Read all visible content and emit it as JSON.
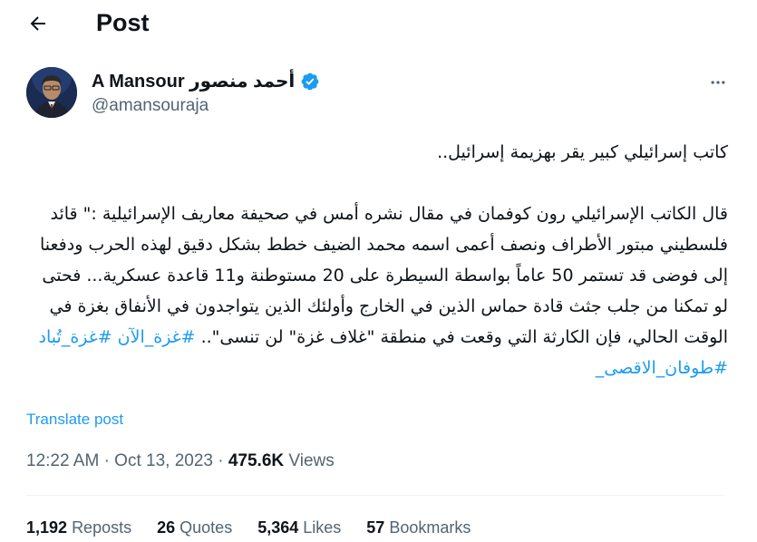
{
  "header": {
    "title": "Post"
  },
  "author": {
    "name": "A Mansour أحمد منصور",
    "handle": "@amansouraja",
    "verified": true
  },
  "tweet": {
    "line1": "كاتب إسرائيلي كبير يقر بهزيمة إسرائيل..",
    "body": "قال الكاتب الإسرائيلي رون كوفمان في مقال نشره أمس في صحيفة معاريف الإسرائيلية :\" قائد فلسطيني مبتور الأطراف ونصف أعمى اسمه محمد الضيف خطط بشكل دقيق لهذه الحرب ودفعنا إلى فوضى قد تستمر 50 عاماً بواسطة السيطرة على 20 مستوطنة و11 قاعدة عسكرية... فحتى لو تمكنا من جلب جثث قادة حماس الذين في الخارج وأولئك الذين يتواجدون في الأنفاق بغزة في الوقت الحالي، فإن الكارثة التي وقعت في منطقة \"غلاف غزة\" لن تنسى\"..",
    "hashtag1": "#غزة_الآن",
    "hashtag2": "#غزة_تُباد",
    "hashtag3": "#طوفان_الاقصى_"
  },
  "translate_label": "Translate post",
  "meta": {
    "time": "12:22 AM",
    "date": "Oct 13, 2023",
    "views_count": "475.6K",
    "views_label": "Views"
  },
  "stats": {
    "reposts_count": "1,192",
    "reposts_label": "Reposts",
    "quotes_count": "26",
    "quotes_label": "Quotes",
    "likes_count": "5,364",
    "likes_label": "Likes",
    "bookmarks_count": "57",
    "bookmarks_label": "Bookmarks"
  },
  "colors": {
    "accent": "#1d9bf0",
    "text_primary": "#0f1419",
    "text_secondary": "#536471",
    "divider": "#eff3f4"
  },
  "icons": {
    "back": "arrow-left-icon",
    "verified": "verified-badge-icon",
    "more": "more-horizontal-icon"
  }
}
